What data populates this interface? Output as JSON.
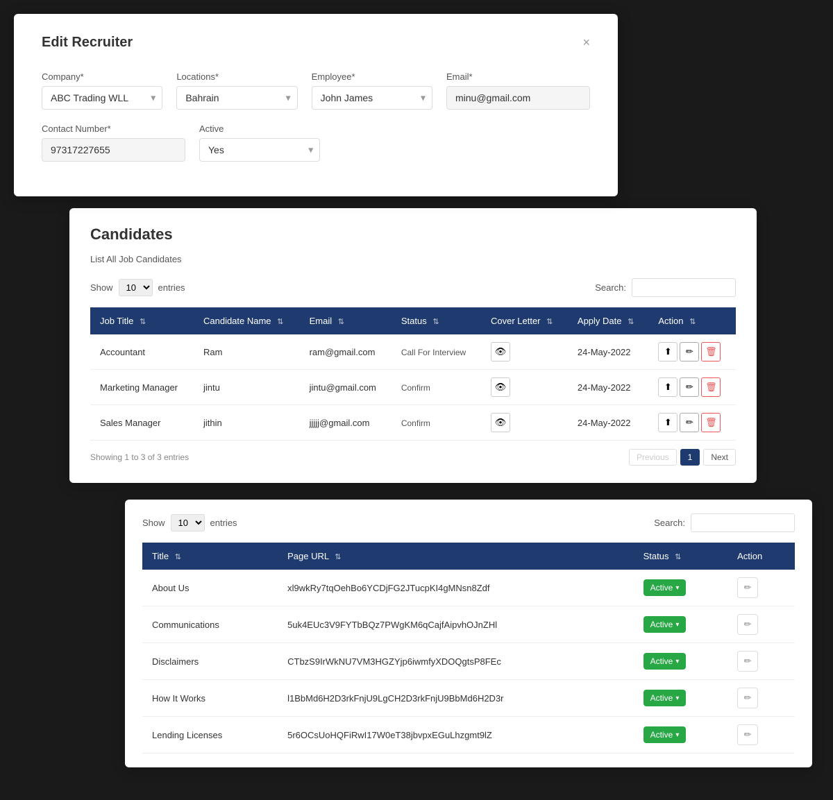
{
  "modal": {
    "title": "Edit Recruiter",
    "close_label": "×",
    "fields": {
      "company_label": "Company*",
      "company_value": "ABC Trading WLL",
      "locations_label": "Locations*",
      "locations_value": "Bahrain",
      "employee_label": "Employee*",
      "employee_value": "John James",
      "email_label": "Email*",
      "email_value": "minu@gmail.com",
      "contact_label": "Contact Number*",
      "contact_value": "97317227655",
      "active_label": "Active",
      "active_value": "Yes"
    }
  },
  "candidates": {
    "panel_title": "Candidates",
    "list_subtitle_pre": "List All",
    "list_subtitle_post": "Job Candidates",
    "show_label": "Show",
    "entries_label": "entries",
    "show_value": "10",
    "search_label": "Search:",
    "table_headers": [
      "Job Title",
      "Candidate Name",
      "Email",
      "Status",
      "Cover Letter",
      "Apply Date",
      "Action"
    ],
    "rows": [
      {
        "job_title": "Accountant",
        "candidate_name": "Ram",
        "email": "ram@gmail.com",
        "status": "Call For Interview",
        "apply_date": "24-May-2022"
      },
      {
        "job_title": "Marketing Manager",
        "candidate_name": "jintu",
        "email": "jintu@gmail.com",
        "status": "Confirm",
        "apply_date": "24-May-2022"
      },
      {
        "job_title": "Sales Manager",
        "candidate_name": "jithin",
        "email": "jjjjj@gmail.com",
        "status": "Confirm",
        "apply_date": "24-May-2022"
      }
    ],
    "footer_showing": "Showing 1 to 3 of 3 entries",
    "prev_label": "Previous",
    "next_label": "Next",
    "page_number": "1"
  },
  "pages_table": {
    "show_label": "Show",
    "entries_label": "entries",
    "show_value": "10",
    "search_label": "Search:",
    "table_headers": [
      "Title",
      "Page URL",
      "Status",
      "Action"
    ],
    "rows": [
      {
        "title": "About Us",
        "page_url": "xl9wkRy7tqOehBo6YCDjFG2JTucpKI4gMNsn8Zdf",
        "status": "Active"
      },
      {
        "title": "Communications",
        "page_url": "5uk4EUc3V9FYTbBQz7PWgKM6qCajfAipvhOJnZHl",
        "status": "Active"
      },
      {
        "title": "Disclaimers",
        "page_url": "CTbzS9IrWkNU7VM3HGZYjp6iwmfyXDOQgtsP8FEc",
        "status": "Active"
      },
      {
        "title": "How It Works",
        "page_url": "l1BbMd6H2D3rkFnjU9LgCH2D3rkFnjU9BbMd6H2D3r",
        "status": "Active"
      },
      {
        "title": "Lending Licenses",
        "page_url": "5r6OCsUoHQFiRwI17W0eT38jbvpxEGuLhzgmt9lZ",
        "status": "Active"
      }
    ]
  }
}
